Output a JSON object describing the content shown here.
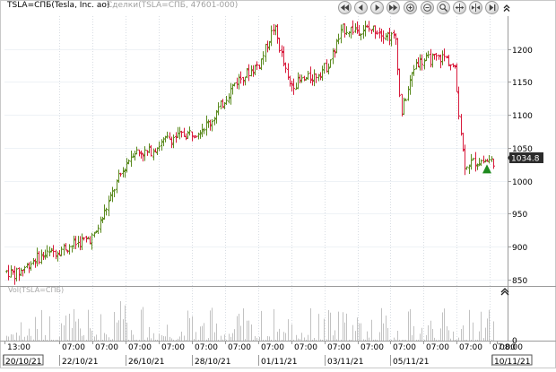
{
  "header": {
    "ticker": "TSLA=СПБ(Tesla, Inc. ao)",
    "subtitle": "Сделки(TSLA=СПБ, 47601-000)"
  },
  "volume_panel": {
    "label": "Vol(TSLA=СПБ)"
  },
  "toolbar": {
    "buttons": [
      {
        "name": "scroll-first-button",
        "icon": "double-left-icon"
      },
      {
        "name": "scroll-left-button",
        "icon": "left-arrow-icon"
      },
      {
        "name": "scroll-right-button",
        "icon": "right-arrow-icon"
      },
      {
        "name": "scroll-last-button",
        "icon": "double-right-icon"
      },
      {
        "name": "zoom-in-button",
        "icon": "plus-icon"
      },
      {
        "name": "zoom-out-button",
        "icon": "minus-icon"
      },
      {
        "name": "zoom-reset-button",
        "icon": "magnifier-icon"
      },
      {
        "name": "expand-button",
        "icon": "expand-icon"
      },
      {
        "name": "shrink-button",
        "icon": "shrink-icon"
      },
      {
        "name": "bar-end-button",
        "icon": "bar-end-icon"
      },
      {
        "name": "collapse-button",
        "icon": "chevron-up-icon"
      }
    ]
  },
  "colors": {
    "up_bar": "#5a8a1e",
    "down_bar": "#d81b3c",
    "grid": "#eef2f6",
    "axis": "#9a9a9a",
    "volume_bar": "#c2c2c2",
    "price_marker_bg": "#2b2b2b",
    "price_marker_text": "#ffffff",
    "signal_marker": "#1e8a1e"
  },
  "chart_data": {
    "type": "ohlc",
    "ylim": [
      840,
      1250
    ],
    "y_ticks": [
      850,
      900,
      950,
      1000,
      1050,
      1100,
      1150,
      1200
    ],
    "last_price": 1034.8,
    "last_price_label": "1034.8",
    "volume_axis_tick": "0",
    "x_time_labels": [
      "13:00",
      "07:00",
      "07:00",
      "07:00",
      "07:00",
      "07:00",
      "07:00",
      "07:00",
      "07:00",
      "07:00",
      "07:00",
      "07:00",
      "07:00",
      "07:00",
      "07:00",
      "08:00"
    ],
    "x_date_labels": [
      "20/10/21",
      "22/10/21",
      "26/10/21",
      "28/10/21",
      "01/11/21",
      "03/11/21",
      "05/11/21",
      "10/11/21"
    ],
    "signal_marker": {
      "type": "buy-arrow",
      "price": 1018
    },
    "anchors": [
      [
        862,
        0.0
      ],
      [
        858,
        0.02
      ],
      [
        882,
        0.06
      ],
      [
        898,
        0.12
      ],
      [
        915,
        0.18
      ],
      [
        1003,
        0.23
      ],
      [
        1045,
        0.26
      ],
      [
        1042,
        0.29
      ],
      [
        1063,
        0.33
      ],
      [
        1075,
        0.39
      ],
      [
        1090,
        0.42
      ],
      [
        1150,
        0.47
      ],
      [
        1178,
        0.52
      ],
      [
        1235,
        0.55
      ],
      [
        1145,
        0.58
      ],
      [
        1158,
        0.63
      ],
      [
        1175,
        0.66
      ],
      [
        1230,
        0.69
      ],
      [
        1230,
        0.76
      ],
      [
        1215,
        0.8
      ],
      [
        1100,
        0.81
      ],
      [
        1180,
        0.84
      ],
      [
        1188,
        0.9
      ],
      [
        1170,
        0.92
      ],
      [
        1025,
        0.94
      ],
      [
        1030,
        0.97
      ]
    ]
  }
}
